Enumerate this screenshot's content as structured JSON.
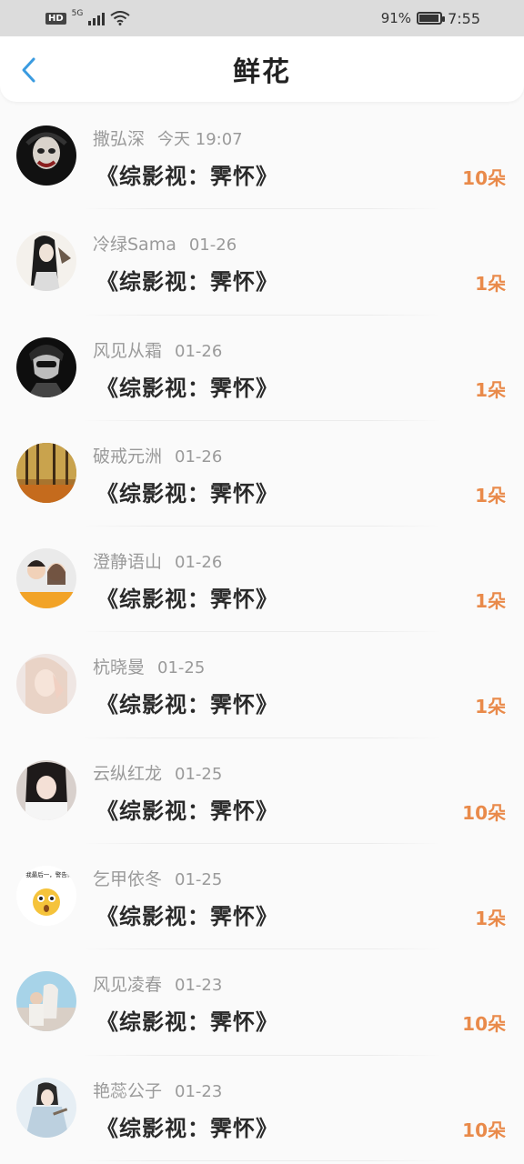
{
  "status_bar": {
    "hd": "HD",
    "network": "5G",
    "battery": "91%",
    "time": "7:55"
  },
  "header": {
    "title": "鲜花"
  },
  "items": [
    {
      "name": "撒弘深",
      "date": "今天 19:07",
      "book": "《综影视：霁怀》",
      "flowers": "10朵"
    },
    {
      "name": "冷绿Sama",
      "date": "01-26",
      "book": "《综影视：霁怀》",
      "flowers": "1朵"
    },
    {
      "name": "风见从霜",
      "date": "01-26",
      "book": "《综影视：霁怀》",
      "flowers": "1朵"
    },
    {
      "name": "破戒元洲",
      "date": "01-26",
      "book": "《综影视：霁怀》",
      "flowers": "1朵"
    },
    {
      "name": "澄静语山",
      "date": "01-26",
      "book": "《综影视：霁怀》",
      "flowers": "1朵"
    },
    {
      "name": "杭晓曼",
      "date": "01-25",
      "book": "《综影视：霁怀》",
      "flowers": "1朵"
    },
    {
      "name": "云纵红龙",
      "date": "01-25",
      "book": "《综影视：霁怀》",
      "flowers": "10朵"
    },
    {
      "name": "乞甲依冬",
      "date": "01-25",
      "book": "《综影视：霁怀》",
      "flowers": "1朵"
    },
    {
      "name": "风见凌春",
      "date": "01-23",
      "book": "《综影视：霁怀》",
      "flowers": "10朵"
    },
    {
      "name": "艳蕊公子",
      "date": "01-23",
      "book": "《综影视：霁怀》",
      "flowers": "10朵"
    }
  ],
  "avatar_sticker_text": "食，我最后一，警告你！",
  "colors": {
    "accent_back": "#3a9be0",
    "flower_count": "#e98a4a",
    "status_bar_bg": "#dcdcdc"
  }
}
